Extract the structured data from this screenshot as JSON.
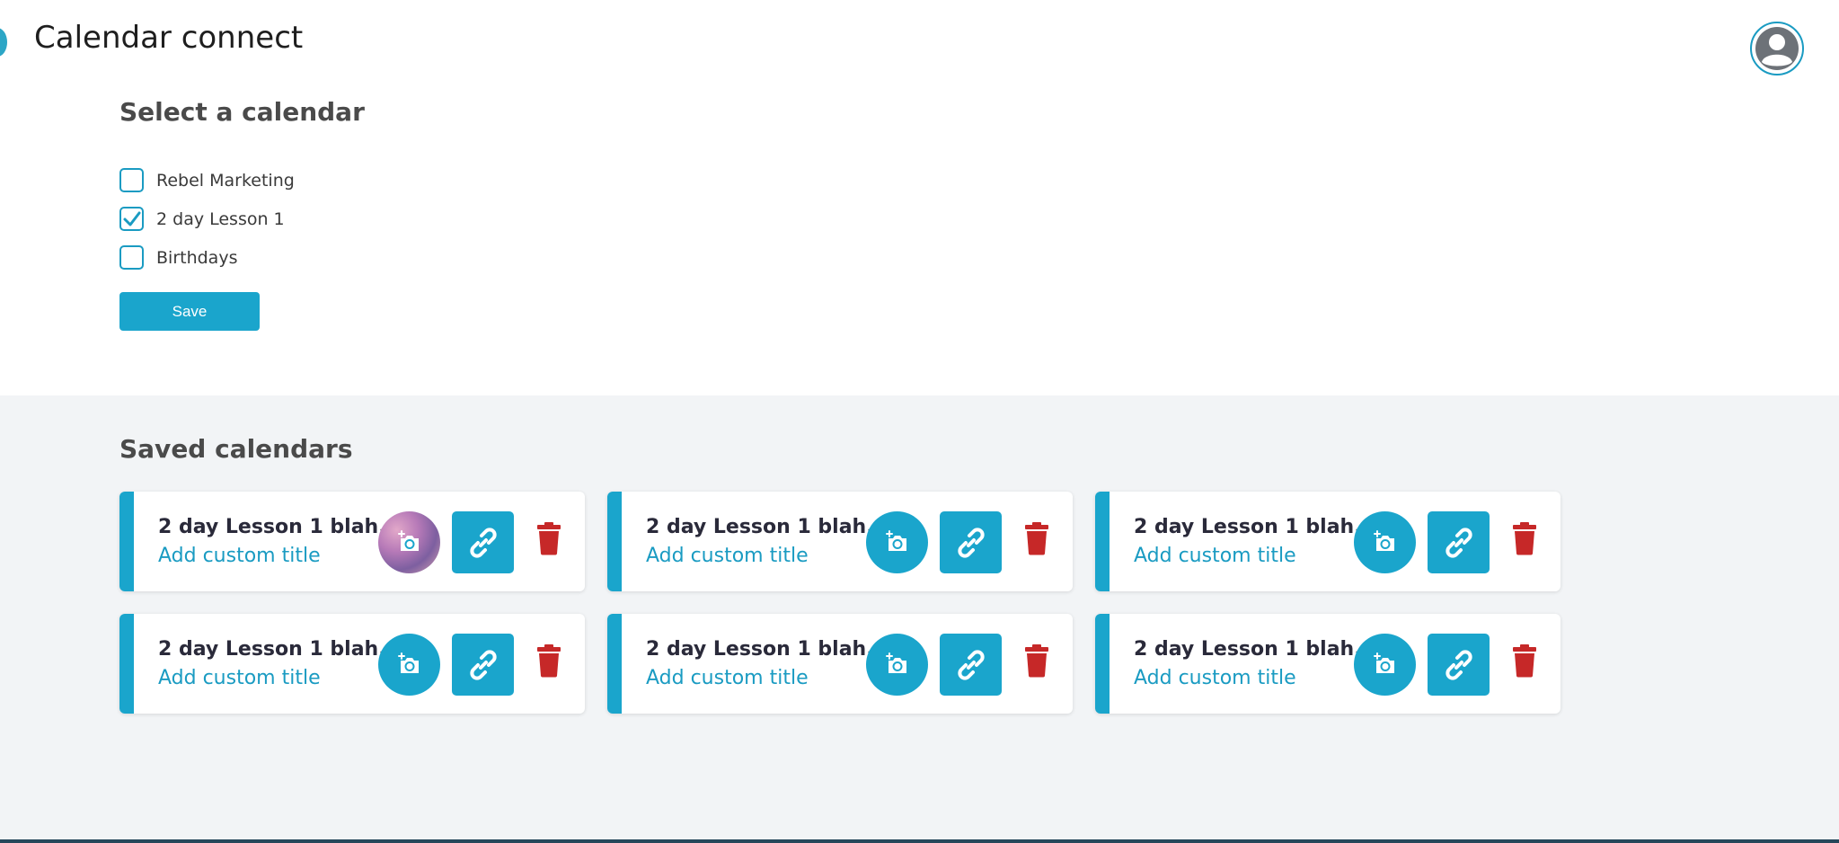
{
  "header": {
    "title": "Calendar connect"
  },
  "select": {
    "heading": "Select a calendar",
    "calendars": [
      {
        "label": "Rebel Marketing",
        "checked": false
      },
      {
        "label": "2 day Lesson 1",
        "checked": true
      },
      {
        "label": "Birthdays",
        "checked": false
      }
    ],
    "save_label": "Save"
  },
  "saved": {
    "heading": "Saved calendars",
    "cards": [
      {
        "title": "2 day Lesson 1 blah...",
        "subtitle": "Add custom title",
        "has_image": true
      },
      {
        "title": "2 day Lesson 1 blah...",
        "subtitle": "Add custom title",
        "has_image": false
      },
      {
        "title": "2 day Lesson 1 blah...",
        "subtitle": "Add custom title",
        "has_image": false
      },
      {
        "title": "2 day Lesson 1 blah...",
        "subtitle": "Add custom title",
        "has_image": false
      },
      {
        "title": "2 day Lesson 1 blah...",
        "subtitle": "Add custom title",
        "has_image": false
      },
      {
        "title": "2 day Lesson 1 blah...",
        "subtitle": "Add custom title",
        "has_image": false
      }
    ]
  },
  "icons": {
    "avatar": "user-circle-icon",
    "checkbox": "checkmark-icon",
    "photo": "add-photo-icon",
    "link": "link-icon",
    "delete": "trash-icon"
  },
  "colors": {
    "accent": "#1aa5cc",
    "danger": "#c62828",
    "background_lower": "#f2f4f6",
    "title_text": "#4a4a4a"
  }
}
